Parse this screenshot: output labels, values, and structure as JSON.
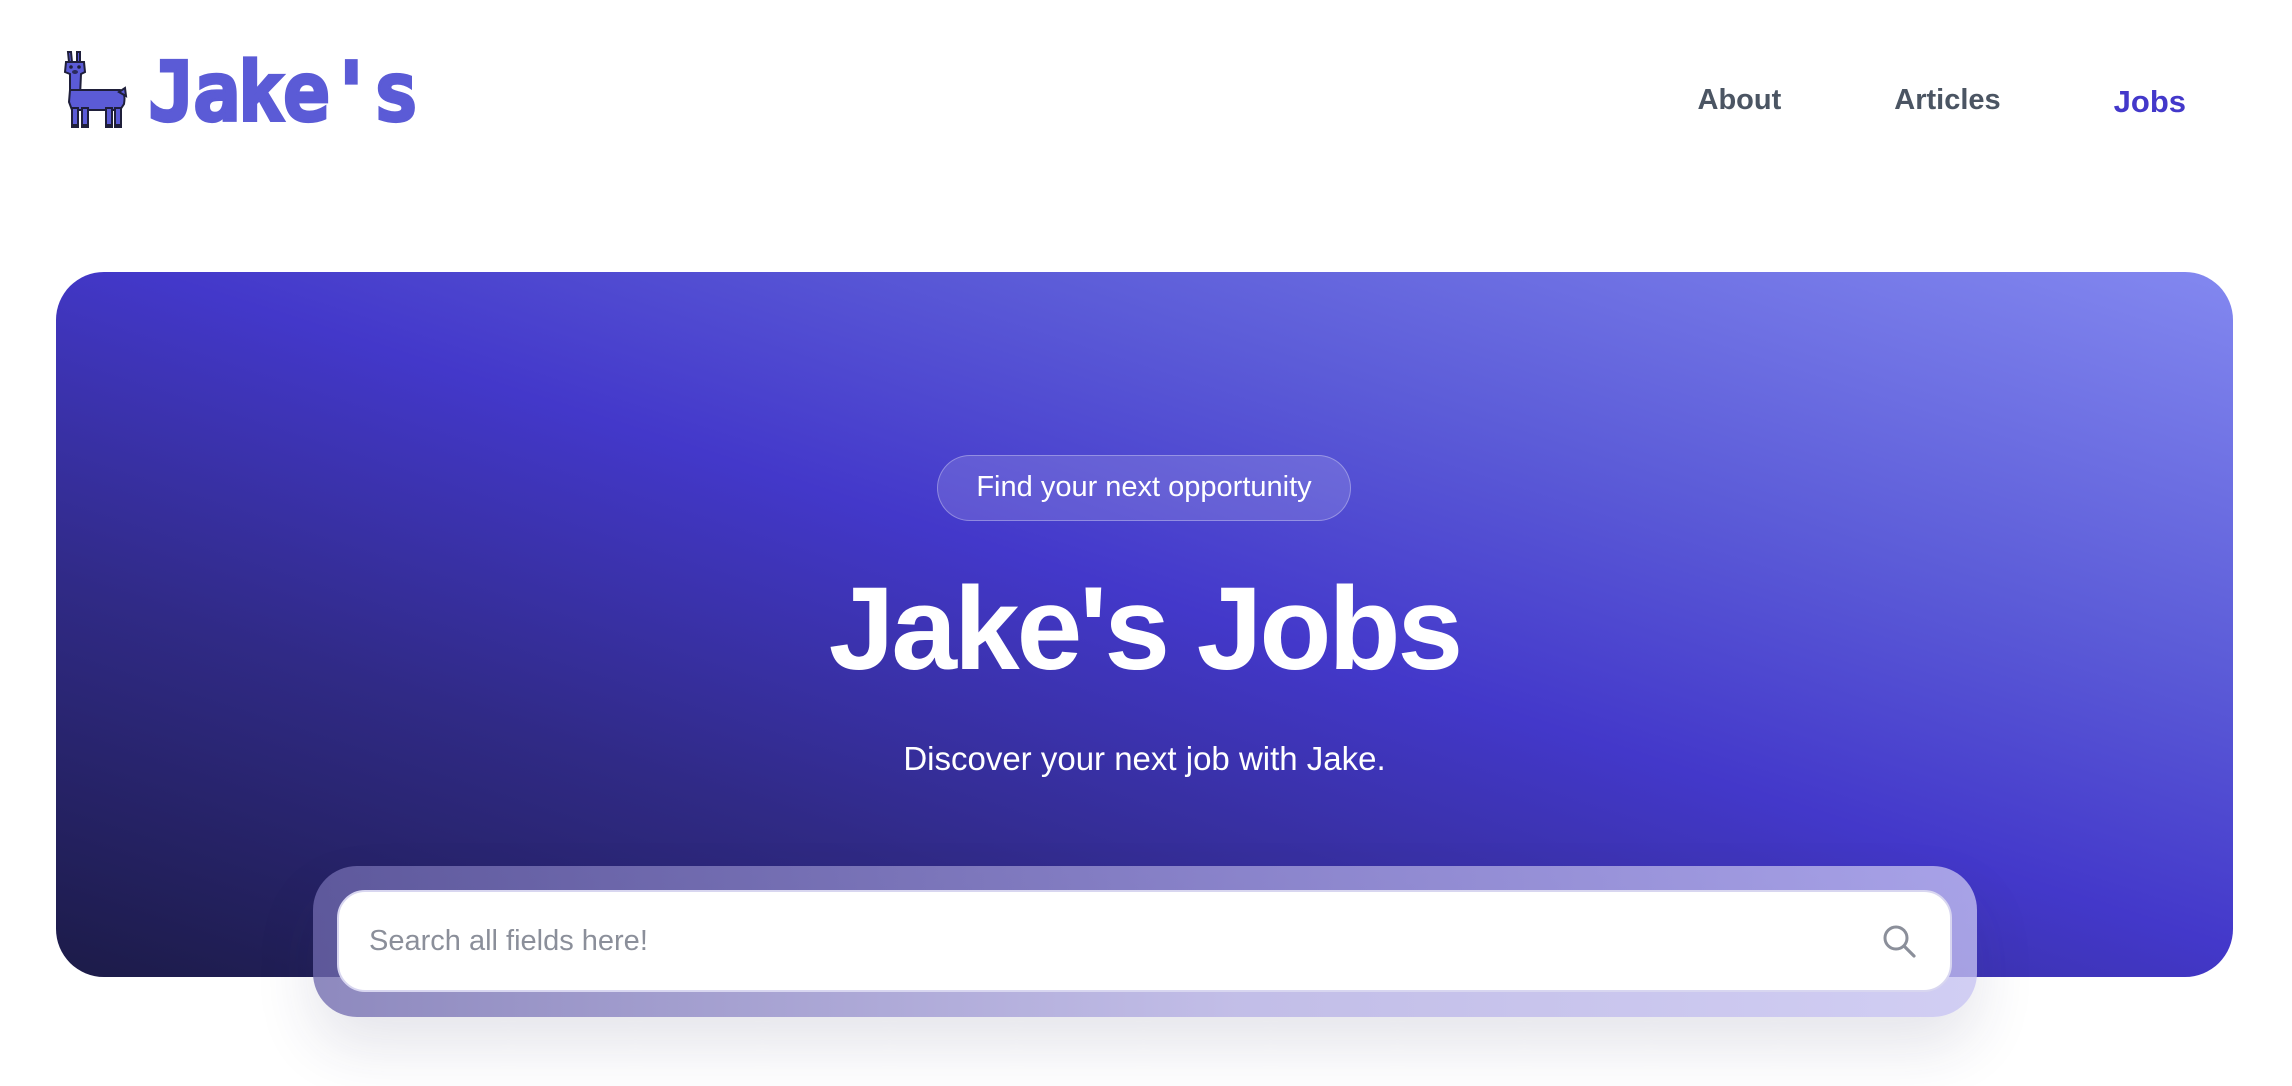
{
  "brand": {
    "wordmark": "Jake's",
    "logo_icon": "llama-icon",
    "color": "#5b5bd6"
  },
  "nav": {
    "items": [
      {
        "label": "About"
      },
      {
        "label": "Articles"
      },
      {
        "label": "Jobs",
        "active": true
      }
    ],
    "active_color": "#4338ca",
    "text_color": "#4b5563"
  },
  "hero": {
    "badge": "Find your next opportunity",
    "title": "Jake's Jobs",
    "subtitle": "Discover your next job with Jake.",
    "gradient": [
      "#1c1b48",
      "#4338ca",
      "#8388f0"
    ]
  },
  "search": {
    "placeholder": "Search all fields here!",
    "value": "",
    "icon": "search-icon"
  }
}
